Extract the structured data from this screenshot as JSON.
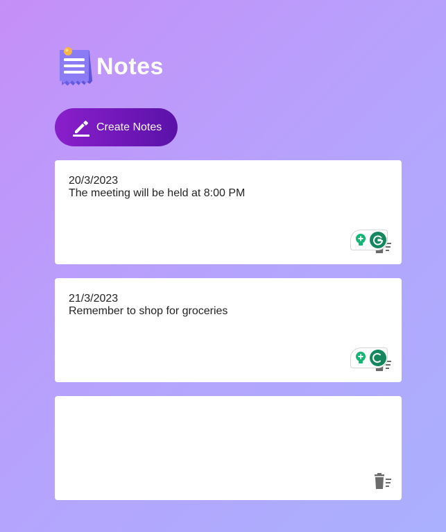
{
  "app": {
    "title": "Notes",
    "logo_icon": "notepad-icon"
  },
  "toolbar": {
    "create_label": "Create Notes",
    "create_icon": "pencil-icon"
  },
  "notes": [
    {
      "date": "20/3/2023",
      "text": "The meeting will be held at 8:00 PM"
    },
    {
      "date": "21/3/2023",
      "text": "Remember to shop for groceries"
    },
    {
      "date": "",
      "text": ""
    }
  ],
  "icons": {
    "delete": "trash-icon",
    "grammarly": "grammarly-icon"
  },
  "colors": {
    "background_gradient": [
      "#c58ff8",
      "#aab0fd"
    ],
    "button": "#7a1bbf",
    "grammarly_green": "#15875f"
  }
}
